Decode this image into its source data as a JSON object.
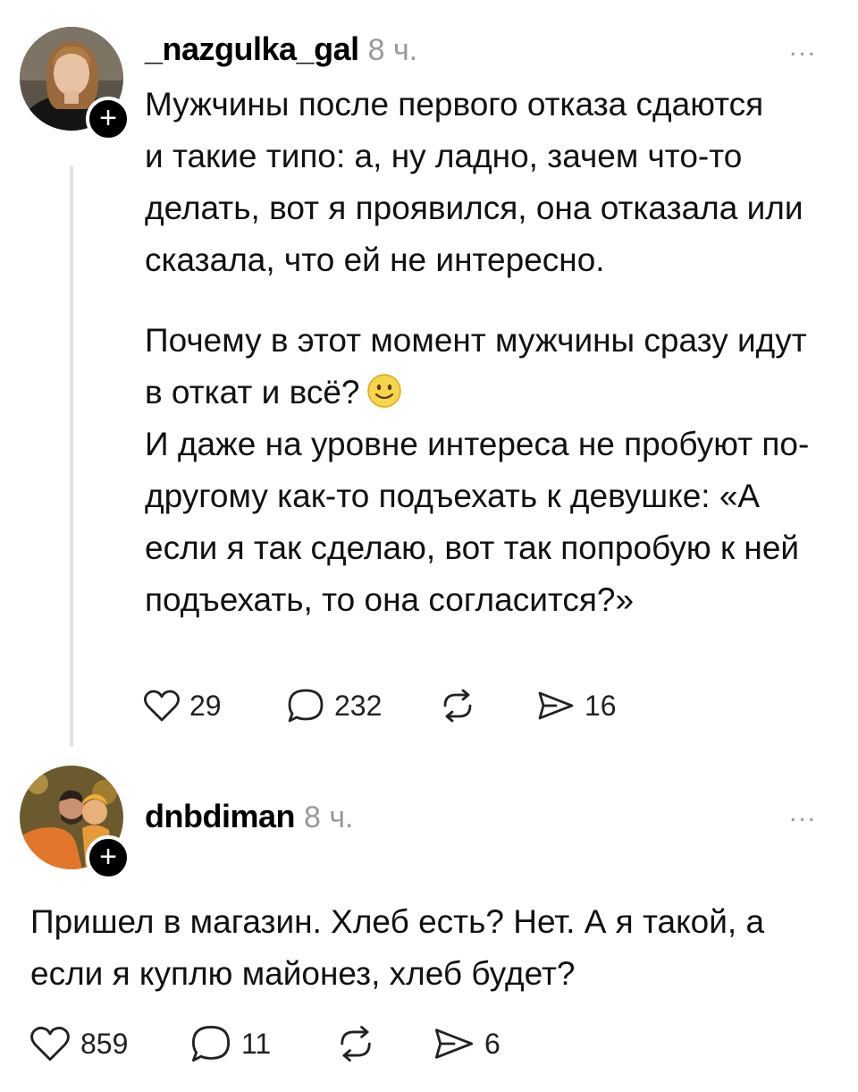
{
  "posts": [
    {
      "username": "_nazgulka_gal",
      "time": "8 ч.",
      "more": "...",
      "paragraphs": [
        "Мужчины после первого отказа сдаются",
        "и такие типо: а, ну ладно, зачем что-то делать, вот я проявился, она отказала или сказала, что ей не интересно.",
        "Почему в этот момент мужчины сразу идут в откат и всё?",
        "И даже на уровне интереса не пробуют по-другому как-то подъехать к девушке: «А если я так сделаю, вот так попробую к ней подъехать, то она согласится?»"
      ],
      "emoji": "slightly-smiling-face-icon",
      "likes": "29",
      "replies": "232",
      "reposts": "",
      "shares": "16"
    },
    {
      "username": "dnbdiman",
      "time": "8 ч.",
      "more": "...",
      "paragraphs": [
        "Пришел в магазин. Хлеб есть? Нет. А я такой, а если я куплю майонез, хлеб будет?"
      ],
      "likes": "859",
      "replies": "11",
      "reposts": "",
      "shares": "6"
    }
  ],
  "follow_symbol": "+",
  "colors": {
    "text": "#111111",
    "muted": "#9a9a9a",
    "thread_line": "#e2e2e2",
    "emoji_yellow": "#f7d54a"
  }
}
